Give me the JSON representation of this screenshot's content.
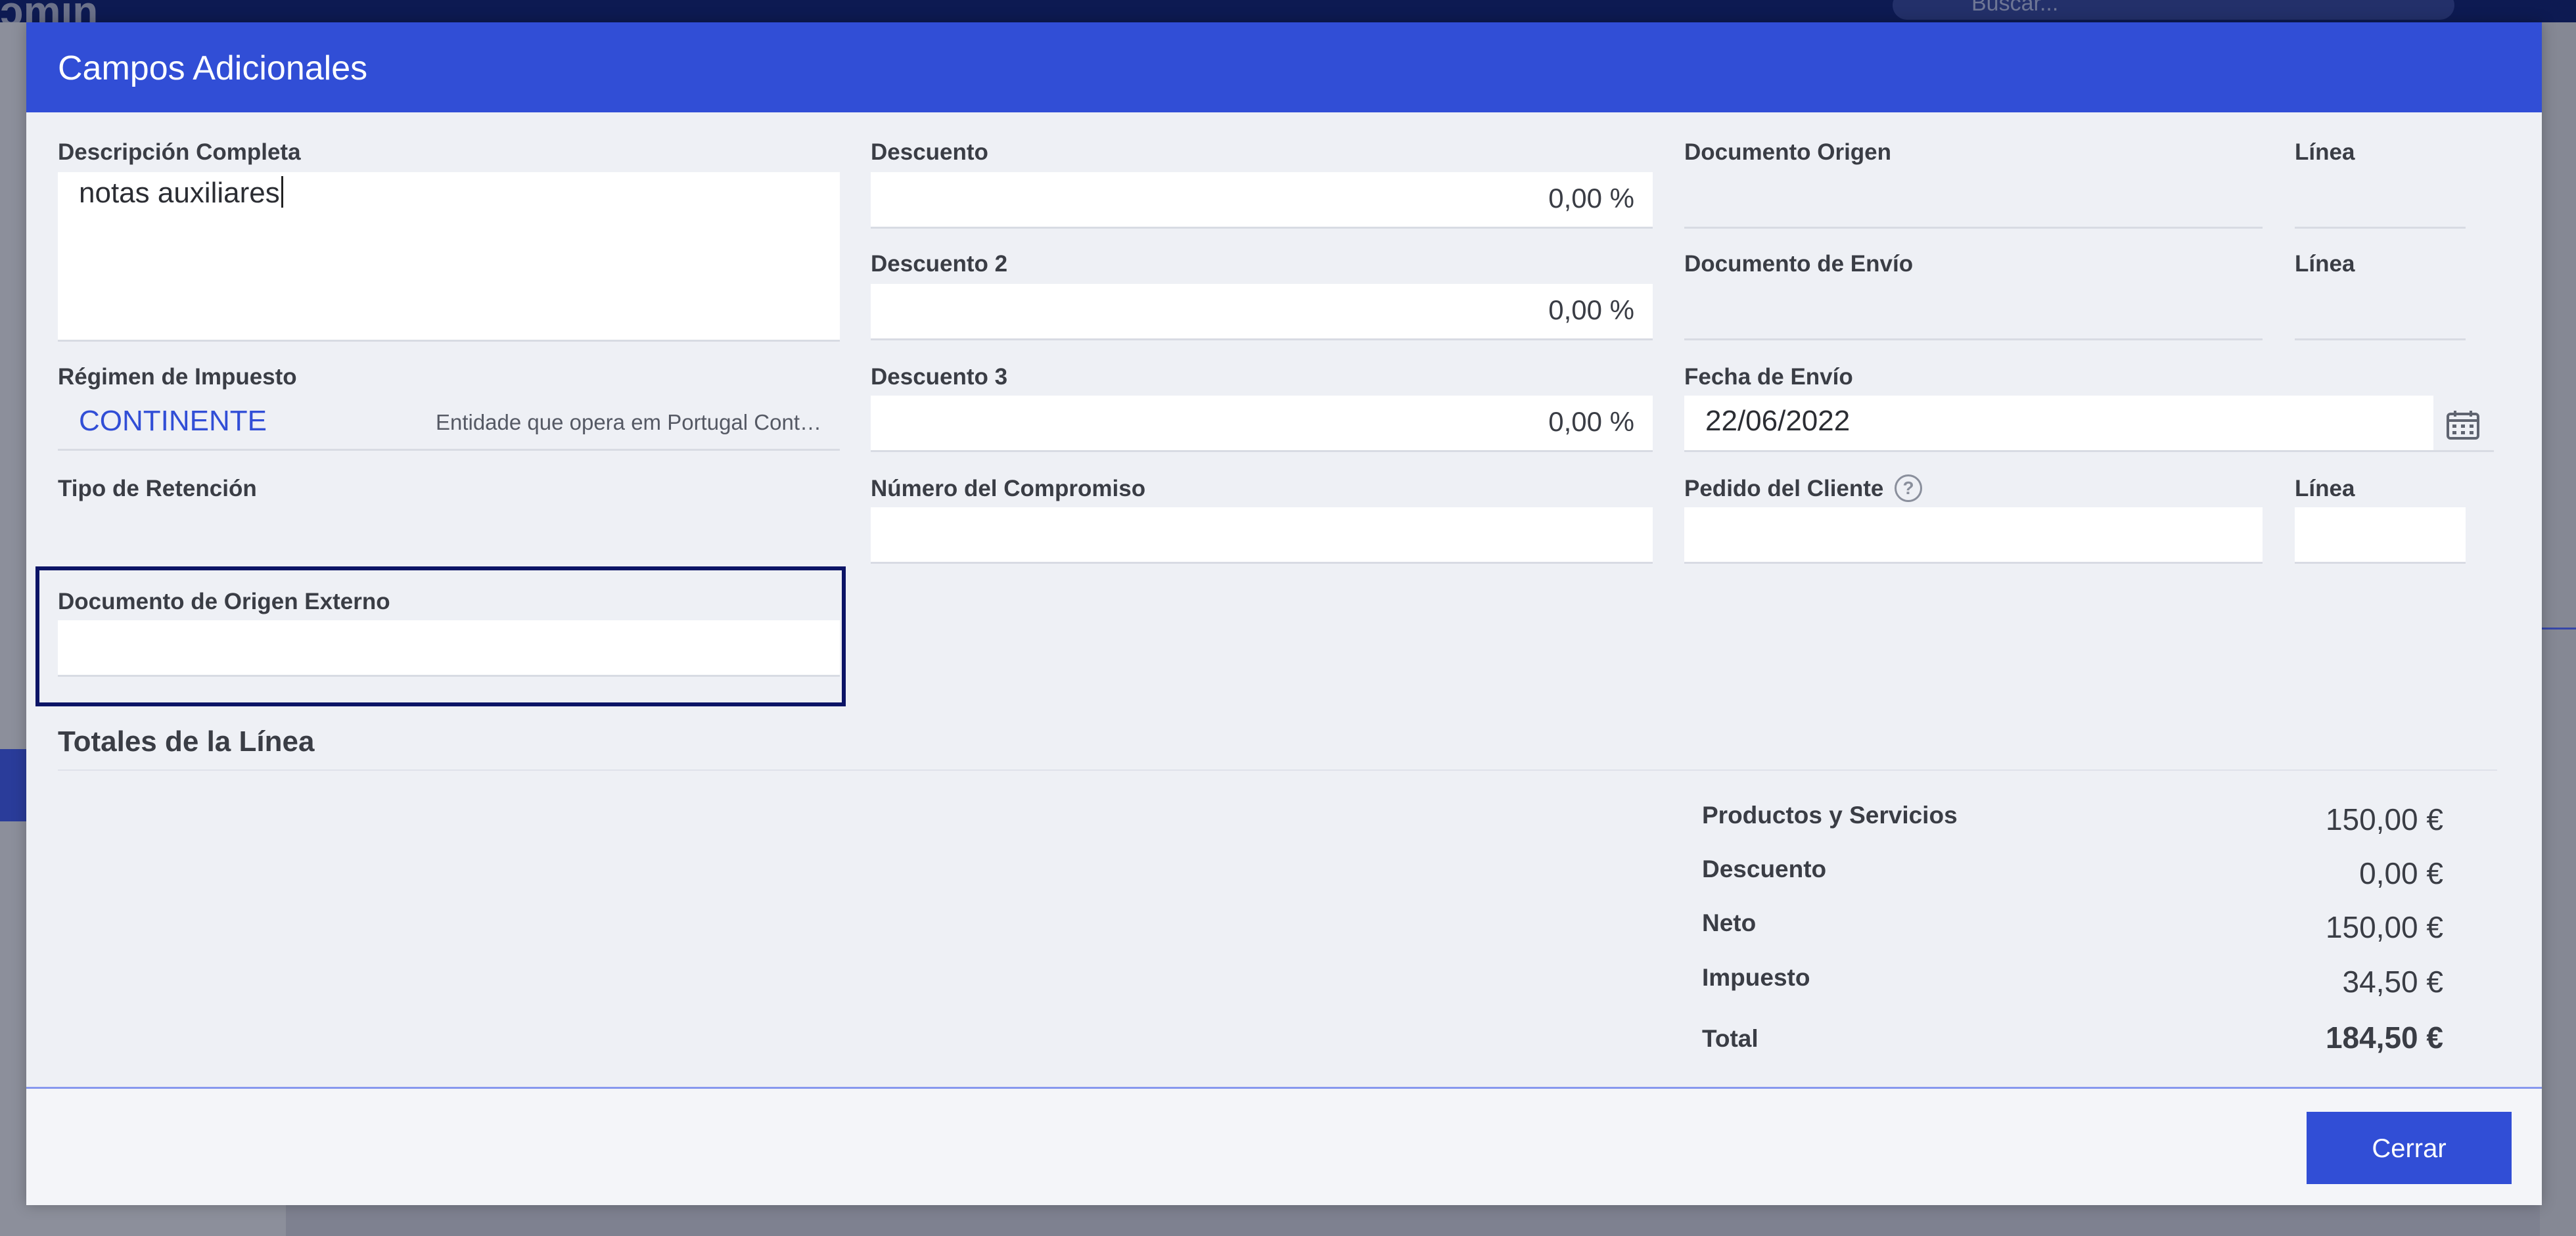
{
  "background": {
    "search_placeholder": "Buscar..."
  },
  "modal": {
    "title": "Campos Adicionales",
    "descripcion": {
      "label": "Descripción Completa",
      "value": "notas auxiliares"
    },
    "regimen": {
      "label": "Régimen de Impuesto",
      "code": "CONTINENTE",
      "description": "Entidade que opera em Portugal Cont…"
    },
    "tipo_retencion": {
      "label": "Tipo de Retención",
      "value": ""
    },
    "doc_origen_externo": {
      "label": "Documento de Origen Externo",
      "value": ""
    },
    "descuento": {
      "label": "Descuento",
      "value": "0,00 %"
    },
    "descuento2": {
      "label": "Descuento 2",
      "value": "0,00 %"
    },
    "descuento3": {
      "label": "Descuento 3",
      "value": "0,00 %"
    },
    "numero_compromiso": {
      "label": "Número del Compromiso",
      "value": ""
    },
    "documento_origen": {
      "label": "Documento Origen",
      "value": ""
    },
    "documento_envio": {
      "label": "Documento de Envío",
      "value": ""
    },
    "fecha_envio": {
      "label": "Fecha de Envío",
      "value": "22/06/2022"
    },
    "pedido_cliente": {
      "label": "Pedido del Cliente",
      "value": ""
    },
    "linea_label": "Línea",
    "totales": {
      "title": "Totales de la Línea",
      "rows": [
        {
          "label": "Productos y Servicios",
          "value": "150,00 €"
        },
        {
          "label": "Descuento",
          "value": "0,00 €"
        },
        {
          "label": "Neto",
          "value": "150,00 €"
        },
        {
          "label": "Impuesto",
          "value": "34,50 €"
        },
        {
          "label": "Total",
          "value": "184,50 €"
        }
      ]
    },
    "close_label": "Cerrar"
  },
  "colors": {
    "header": "#314ed6",
    "highlight_border": "#0c1466",
    "link": "#314ed6"
  }
}
